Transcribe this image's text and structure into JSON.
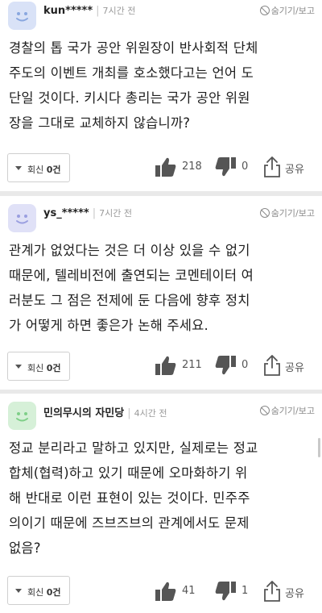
{
  "comments": [
    {
      "author": "kun*****",
      "time": "7시간 전",
      "hide_label": "숨기기/보고",
      "avatar_bg": "#d9e2f7",
      "avatar_fg": "#89a7df",
      "lines": [
        "경찰의 톱 국가 공안 위원장이 반사회적 단체",
        "주도의 이벤트 개최를 호소했다고는 언어 도",
        "단일 것이다. 키시다 총리는 국가 공안 위원",
        "장을 그대로 교체하지 않습니까?"
      ],
      "reply_label": "회신",
      "reply_count": "0건",
      "likes": "218",
      "dislikes": "0",
      "share_label": "공유"
    },
    {
      "author": "ys_*****",
      "time": "7시간 전",
      "hide_label": "숨기기/보고",
      "avatar_bg": "#e0e1f7",
      "avatar_fg": "#9a9fe0",
      "lines": [
        "관계가 없었다는 것은 더 이상 있을 수 없기",
        "때문에, 텔레비전에 출연되는 코멘테이터 여",
        "러분도 그 점은 전제에 둔 다음에 향후 정치",
        "가 어떻게 하면 좋은가 논해 주세요."
      ],
      "reply_label": "회신",
      "reply_count": "0건",
      "likes": "211",
      "dislikes": "0",
      "share_label": "공유"
    },
    {
      "author": "민의무시의 자민당",
      "time": "4시간 전",
      "hide_label": "숨기기/보고",
      "avatar_bg": "#d6f0d8",
      "avatar_fg": "#7fcf88",
      "lines": [
        "정교 분리라고 말하고 있지만, 실제로는 정교",
        "합체(협력)하고 있기 때문에 오마화하기 위",
        "해 반대로 이런 표현이 있는 것이다. 민주주",
        "의이기 때문에 즈브즈브의 관계에서도 문제",
        "없음?"
      ],
      "reply_label": "회신",
      "reply_count": "0건",
      "likes": "41",
      "dislikes": "1",
      "share_label": "공유"
    }
  ]
}
